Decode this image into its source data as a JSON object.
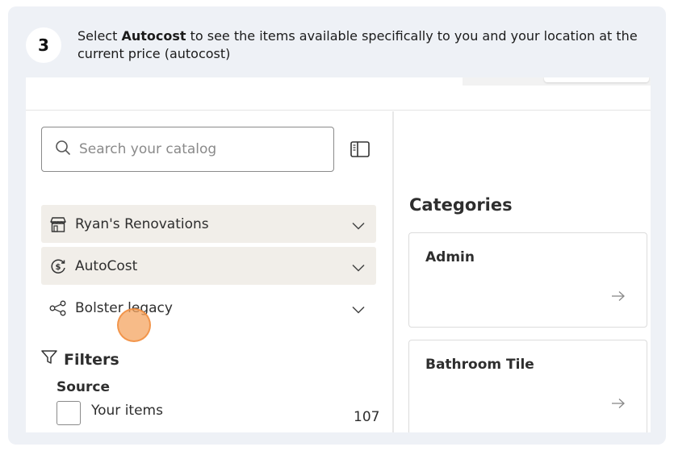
{
  "step": {
    "number": "3",
    "text_before": "Select ",
    "text_bold": "Autocost",
    "text_after": " to see the items available specifically to you and your location at the current price (autocost)"
  },
  "search": {
    "placeholder": "Search your catalog",
    "value": ""
  },
  "selectors": [
    {
      "label": "Ryan's Renovations",
      "icon": "storefront-icon"
    },
    {
      "label": "AutoCost",
      "icon": "dollar-cycle-icon"
    },
    {
      "label": "Bolster legacy",
      "icon": "share-nodes-icon"
    }
  ],
  "filters": {
    "title": "Filters",
    "source_label": "Source",
    "options": [
      {
        "label": "Your items",
        "count": "107"
      }
    ]
  },
  "categories": {
    "title": "Categories",
    "items": [
      {
        "name": "Admin"
      },
      {
        "name": "Bathroom Tile"
      }
    ]
  },
  "colors": {
    "frame_bg": "#eef1f6",
    "row_shade": "#f1eee9",
    "cursor": "#f4a460"
  }
}
